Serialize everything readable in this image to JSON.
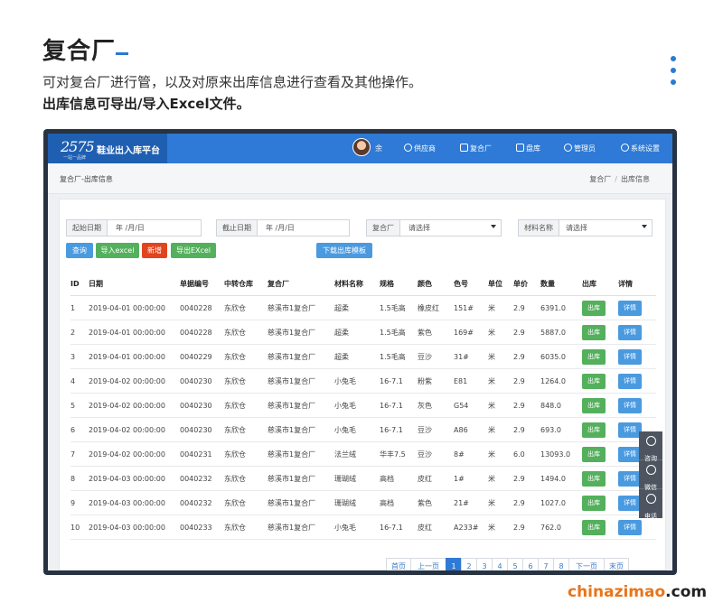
{
  "hero": {
    "title": "复合厂",
    "desc": "可对复合厂进行管，以及对原来出库信息进行查看及其他操作。",
    "desc2": "出库信息可导出/导入Excel文件。"
  },
  "app": {
    "logo": "2575",
    "logo_sub": "一站一品牌",
    "brand": "鞋业出入库平台",
    "user": "余",
    "nav": [
      "供应商",
      "复合厂",
      "盘库",
      "管理员",
      "系统设置"
    ]
  },
  "breadcrumb": {
    "title": "复合厂-出库信息",
    "path": [
      "复合厂",
      "出库信息"
    ]
  },
  "filters": {
    "start_label": "起始日期",
    "start_value": "年 /月/日",
    "end_label": "截止日期",
    "end_value": "年 /月/日",
    "factory_label": "复合厂",
    "factory_value": "请选择",
    "material_label": "材料名称",
    "material_value": "请选择"
  },
  "actions": {
    "query": "查询",
    "import": "导入excel",
    "add": "新增",
    "export": "导出EXcel",
    "download": "下载出库模板"
  },
  "table": {
    "headers": [
      "ID",
      "日期",
      "单据编号",
      "中转仓库",
      "复合厂",
      "材料名称",
      "规格",
      "颜色",
      "色号",
      "单位",
      "单价",
      "数量",
      "出库",
      "详情"
    ],
    "out_label": "出库",
    "detail_label": "详情",
    "rows": [
      [
        "1",
        "2019-04-01 00:00:00",
        "0040228",
        "东欣仓",
        "慈溪市1复合厂",
        "超柔",
        "1.5毛高",
        "橡皮红",
        "151#",
        "米",
        "2.9",
        "6391.0"
      ],
      [
        "2",
        "2019-04-01 00:00:00",
        "0040228",
        "东欣仓",
        "慈溪市1复合厂",
        "超柔",
        "1.5毛高",
        "紫色",
        "169#",
        "米",
        "2.9",
        "5887.0"
      ],
      [
        "3",
        "2019-04-01 00:00:00",
        "0040229",
        "东欣仓",
        "慈溪市1复合厂",
        "超柔",
        "1.5毛高",
        "豆沙",
        "31#",
        "米",
        "2.9",
        "6035.0"
      ],
      [
        "4",
        "2019-04-02 00:00:00",
        "0040230",
        "东欣仓",
        "慈溪市1复合厂",
        "小兔毛",
        "16-7.1",
        "粉紫",
        "E81",
        "米",
        "2.9",
        "1264.0"
      ],
      [
        "5",
        "2019-04-02 00:00:00",
        "0040230",
        "东欣仓",
        "慈溪市1复合厂",
        "小兔毛",
        "16-7.1",
        "灰色",
        "G54",
        "米",
        "2.9",
        "848.0"
      ],
      [
        "6",
        "2019-04-02 00:00:00",
        "0040230",
        "东欣仓",
        "慈溪市1复合厂",
        "小兔毛",
        "16-7.1",
        "豆沙",
        "A86",
        "米",
        "2.9",
        "693.0"
      ],
      [
        "7",
        "2019-04-02 00:00:00",
        "0040231",
        "东欣仓",
        "慈溪市1复合厂",
        "法兰绒",
        "华丰7.5",
        "豆沙",
        "8#",
        "米",
        "6.0",
        "13093.0"
      ],
      [
        "8",
        "2019-04-03 00:00:00",
        "0040232",
        "东欣仓",
        "慈溪市1复合厂",
        "珊瑚绒",
        "高档",
        "皮红",
        "1#",
        "米",
        "2.9",
        "1494.0"
      ],
      [
        "9",
        "2019-04-03 00:00:00",
        "0040232",
        "东欣仓",
        "慈溪市1复合厂",
        "珊瑚绒",
        "高档",
        "紫色",
        "21#",
        "米",
        "2.9",
        "1027.0"
      ],
      [
        "10",
        "2019-04-03 00:00:00",
        "0040233",
        "东欣仓",
        "慈溪市1复合厂",
        "小兔毛",
        "16-7.1",
        "皮红",
        "A233#",
        "米",
        "2.9",
        "762.0"
      ]
    ]
  },
  "pager": {
    "items": [
      "首页",
      "上一页",
      "1",
      "2",
      "3",
      "4",
      "5",
      "6",
      "7",
      "8",
      "下一页",
      "末页"
    ],
    "active": "1"
  },
  "float": [
    "咨询",
    "微信",
    "电话"
  ],
  "watermark": {
    "orange": "chinazimao",
    "dark": ".com"
  },
  "colors": {
    "primary": "#2e7ad6",
    "success": "#54b05c",
    "danger": "#e0451f",
    "frame": "#273342"
  }
}
